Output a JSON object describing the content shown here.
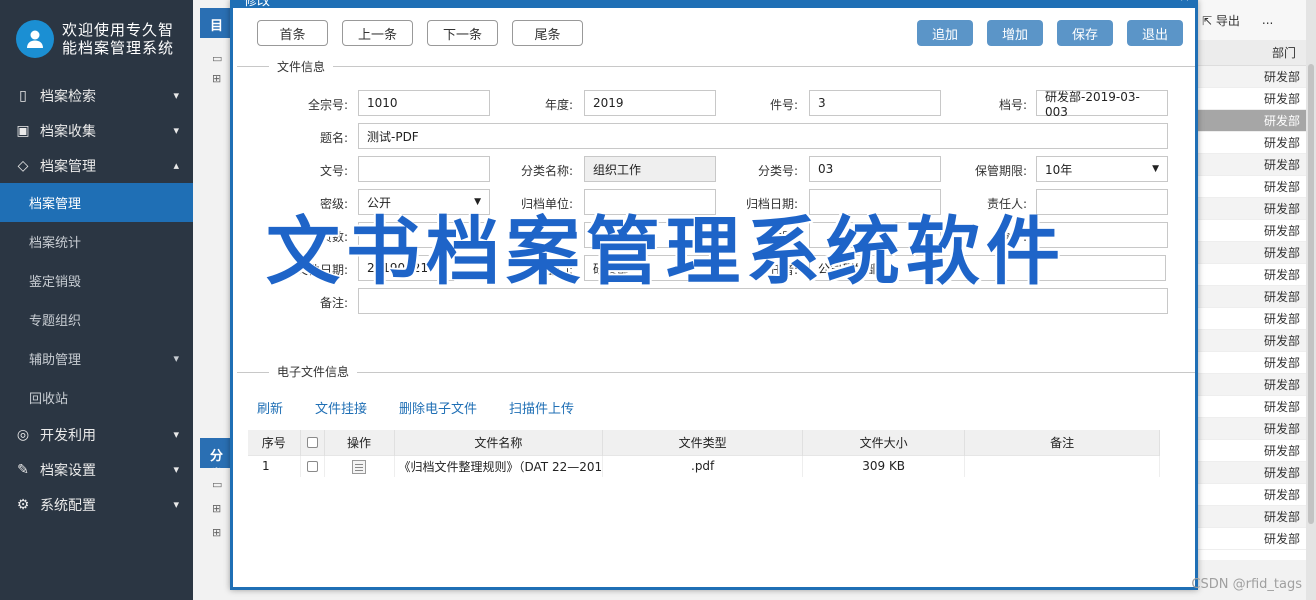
{
  "sidebar": {
    "app_title": "欢迎使用专久智能档案管理系统",
    "items": [
      {
        "label": "档案检索",
        "icon": "document-icon",
        "chev": "▾"
      },
      {
        "label": "档案收集",
        "icon": "inbox-icon",
        "chev": "▾"
      },
      {
        "label": "档案管理",
        "icon": "tag-icon",
        "chev": "▴"
      }
    ],
    "sub_items": [
      {
        "label": "档案管理",
        "active": true
      },
      {
        "label": "档案统计"
      },
      {
        "label": "鉴定销毁"
      },
      {
        "label": "专题组织"
      },
      {
        "label": "辅助管理",
        "chev": "▾"
      },
      {
        "label": "回收站"
      }
    ],
    "bottom_items": [
      {
        "label": "开发利用",
        "icon": "bulb-icon",
        "chev": "▾"
      },
      {
        "label": "档案设置",
        "icon": "pencil-icon",
        "chev": "▾"
      },
      {
        "label": "系统配置",
        "icon": "gear-icon",
        "chev": "▾"
      }
    ]
  },
  "background": {
    "panel_top_label": "目录",
    "panel_bottom_label": "分类",
    "toolbar_export": "导出",
    "toolbar_more": "...",
    "col_header": "部门",
    "dept_value": "研发部",
    "dept_rows": 22
  },
  "dialog": {
    "title": "修改",
    "close": "×",
    "nav_buttons": [
      "首条",
      "上一条",
      "下一条",
      "尾条"
    ],
    "action_buttons": [
      "追加",
      "增加",
      "保存",
      "退出"
    ],
    "section_file_info": "文件信息",
    "section_e_file": "电子文件信息",
    "fields": {
      "fonds_no_label": "全宗号:",
      "fonds_no": "1010",
      "year_label": "年度:",
      "year": "2019",
      "item_no_label": "件号:",
      "item_no": "3",
      "archive_no_label": "档号:",
      "archive_no": "研发部-2019-03-003",
      "title_label": "题名:",
      "title": "测试-PDF",
      "doc_no_label": "文号:",
      "doc_no": "",
      "category_name_label": "分类名称:",
      "category_name": "组织工作",
      "category_no_label": "分类号:",
      "category_no": "03",
      "retention_label": "保管期限:",
      "retention": "10年",
      "secret_label": "密级:",
      "secret": "公开",
      "filing_unit_label": "归档单位:",
      "filing_unit": "",
      "filing_date_label": "归档日期:",
      "filing_date": "",
      "responsible_label": "责任人:",
      "responsible": "",
      "pages_label": "页数:",
      "pages": "",
      "count_label": "",
      "count": "0",
      "type_label": "类别:",
      "type": "",
      "box_no_label": "盒号:",
      "box_no": "",
      "file_date_label": "文件日期:",
      "file_date": "20190521",
      "dept_label": "部门:",
      "dept": "研发部",
      "author_label": "责任者:",
      "author": "公司研发部",
      "remark_label": "备注:",
      "remark": ""
    },
    "links": [
      "刷新",
      "文件挂接",
      "删除电子文件",
      "扫描件上传"
    ],
    "table": {
      "headers": [
        "序号",
        "",
        "操作",
        "文件名称",
        "文件类型",
        "文件大小",
        "备注"
      ],
      "rows": [
        {
          "no": "1",
          "name": "《归档文件整理规则》（DAT 22—201",
          "type": ".pdf",
          "size": "309 KB",
          "remark": ""
        }
      ]
    }
  },
  "banner": "文书档案管理系统软件",
  "credit": "CSDN @rfid_tags"
}
